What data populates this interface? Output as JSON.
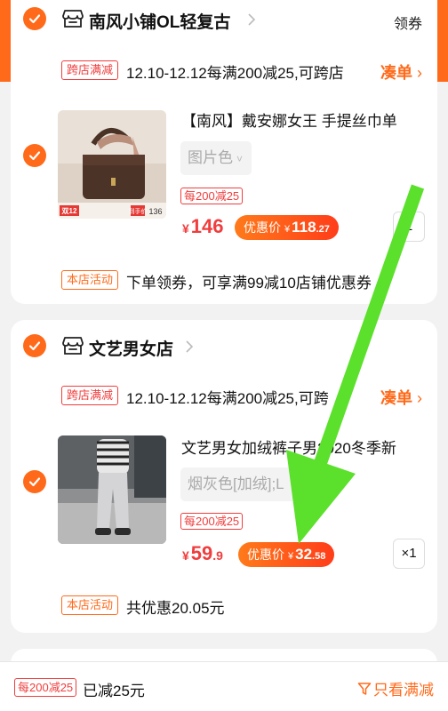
{
  "colors": {
    "accent": "#ff6a1a",
    "price_red": "#f03d3d",
    "annotation_green": "#5be02b"
  },
  "shops": [
    {
      "name": "南风小铺OL轻复古",
      "coupon_label": "领券",
      "promo": {
        "tag": "跨店满减",
        "text": "12.10-12.12每满200减25,可跨店",
        "link": "凑单"
      },
      "item": {
        "title": "【南风】戴安娜女王 手提丝巾单",
        "sku": "图片色",
        "promo_tag": "每200减25",
        "price": {
          "currency": "¥",
          "integer": "146",
          "decimal": ""
        },
        "discount": {
          "label": "优惠价",
          "currency": "¥",
          "integer": "118",
          "decimal": ".27"
        },
        "qty": "1",
        "thumb_badges": {
          "event": "双12",
          "caption": "到手价",
          "value": "136"
        }
      },
      "activity": {
        "tag": "本店活动",
        "text": "下单领券，可享满99减10店铺优惠券"
      }
    },
    {
      "name": "文艺男女店",
      "promo": {
        "tag": "跨店满减",
        "text": "12.10-12.12每满200减25,可跨",
        "link": "凑单"
      },
      "item": {
        "title": "文艺男女加绒裤子男2020冬季新",
        "sku": "烟灰色[加绒];L",
        "promo_tag": "每200减25",
        "price": {
          "currency": "¥",
          "integer": "59",
          "decimal": ".9"
        },
        "discount": {
          "label": "优惠价",
          "currency": "¥",
          "integer": "32",
          "decimal": ".58"
        },
        "qty": "×1"
      },
      "activity": {
        "tag": "本店活动",
        "text": "共优惠20.05元"
      }
    }
  ],
  "bottom_bar": {
    "tag": "每200减25",
    "saved": "已减25元",
    "filter": "只看满减"
  },
  "icons": [
    "check-icon",
    "shop-icon",
    "chevron-right-icon",
    "filter-icon",
    "annotation-arrow"
  ]
}
